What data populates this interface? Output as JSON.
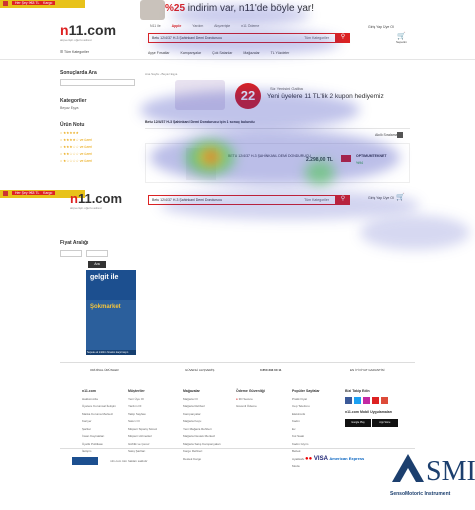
{
  "banner": {
    "tag1": "Her Şey 9€8 TL",
    "tag2": "Kargo",
    "promo_prefix": "%25",
    "promo_text": "indirim var, n11'de böyle yar!"
  },
  "header": {
    "logo_n": "n",
    "logo_rest": "11.com",
    "logo_sub": "alışverişin uğurlu adresi",
    "top_links": [
      "N11 ile",
      "Apple",
      "Yardım",
      "Alışverişte",
      "n11 Ödeme"
    ],
    "login": "Giriş Yap Üye Ol",
    "account": "Sepetim",
    "search_value": "Betu 12/4/37 H-3 Şahinkanl Demi Dondurucu",
    "search_category": "Tüm Kategoriler",
    "categories_label": "Tüm Kategoriler"
  },
  "nav": [
    "Ayşe Fırsatlar",
    "Kampanyalar",
    "Çok Satanlar",
    "Mağazalar",
    "TL Yüzdeler"
  ],
  "sidebar": {
    "title": "Sonuçlarda Ara",
    "categories": "Kategoriler",
    "category_item": "Beyaz Eşya",
    "rating": "Ürün Notu",
    "ratings": [
      "★★★★★",
      "★★★★☆ ve üzeri",
      "★★★☆☆ ve üzeri",
      "★★☆☆☆ ve üzeri",
      "★☆☆☆☆ ve üzeri"
    ],
    "price": "Fiyat Aralığı",
    "price_button": "Ara"
  },
  "main": {
    "breadcrumb": "Ana Sayfa › Beyaz Eşya",
    "campaign_title": "Siz Yenisini Galiba",
    "campaign_text": "Yeni üyelere 11 TL'lik 2 kupon hediyemiz",
    "campaign_number": "22",
    "result_text": "Betu 12/4/37 H-3 Şahinkanl Demi Dondurucu için 1 sonuç bulundu",
    "sort_label": "Akıllı Sıralama",
    "product_name": "BETU 12/4/37 H-3 ŞAHİNKANL DEMİ DONDURUCU",
    "product_price": "2.298,00 TL",
    "store_label": "OPTIMUMTEKNET",
    "store_rating": "%94",
    "add_cart": "Sepete Ekle"
  },
  "ads": {
    "ad1": "gelgit ile",
    "ad1_bottom": "Sepette ek indirim fırsatını kaçırma",
    "ad2": "Şokmarket",
    "ad2_bottom": "Sepete ek indirim fırsatını kaçırmayın"
  },
  "footer": {
    "features": [
      "ORİJİNAL ÜRÜNLER",
      "GÜVENLİ ALIŞVERİŞ",
      "0 850 333 00 11",
      "EN İYİ FİYAT GARANTİSİ"
    ],
    "col1_title": "n11.com",
    "col1": [
      "Hakkımızda",
      "Üyelere Kurumsal İletişim",
      "Marka Koruma Merkezi",
      "Kariyer",
      "Şartlar",
      "İnsan Kaynakları",
      "Üyelik Politikası",
      "İletişim"
    ],
    "col2_title": "Müşteriler",
    "col2": [
      "Yeni Üye Ol",
      "Yardım Ol",
      "Takip Sayfası",
      "Satıcı Ol",
      "Müşteri Sipariş Süreci",
      "Müşteri Hizmetleri",
      "Gizlilik ve Çerez",
      "Satış Şartları"
    ],
    "col3_title": "Mağazalar",
    "col3": [
      "Mağaza Ol",
      "Mağaza Rehberi",
      "Kampanyalar",
      "Mağaza Koçu",
      "Yeni Mağaza Rehberi",
      "Mağaza Destek Merkezi",
      "Mağaza Satış Kampanyaları",
      "Kargo Rehberi",
      "Destek Kargo"
    ],
    "col4_title": "Ödeme Güvenliği",
    "col4": [
      "3D Secure",
      "Güvenli Ödeme"
    ],
    "col5_title": "Popüler Sayfalar",
    "col5": [
      "Pratik Fiyat",
      "Cep Telefonu",
      "Elektronik",
      "Kadın",
      "Ev",
      "Kol Saati",
      "Kadın Giyim",
      "Bebek",
      "Ayakkabı",
      "Moda"
    ],
    "social_title": "Bizi Takip Edin",
    "app_title": "n11.com Mobil Uygulamaları",
    "app1": "Google Play",
    "app2": "App Store",
    "bottom_text": "n11.com tüm hakları saklıdır",
    "payments": [
      "VISA",
      "MasterCard",
      "American Express"
    ],
    "watermark_text": "SensoMotoric Instrument"
  },
  "colors": {
    "accent": "#d92121",
    "yellow": "#e8c21a",
    "brand_blue": "#1c4f8f"
  }
}
